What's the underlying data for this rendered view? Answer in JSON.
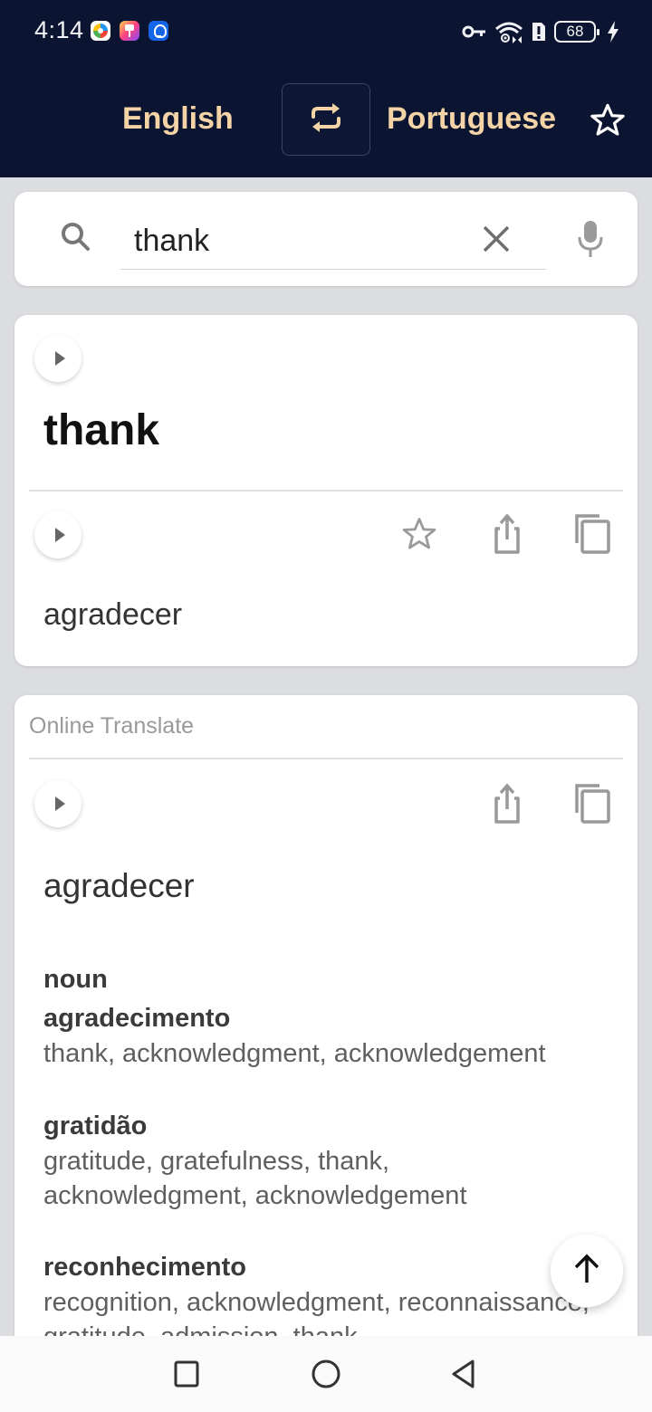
{
  "status_bar": {
    "time": "4:14",
    "notification_icons": [
      "app-icon-colorful-circle",
      "app-icon-paintbrush",
      "app-icon-lightbulb"
    ],
    "right_icons": [
      "vpn-key-icon",
      "wifi-icon",
      "sim-alert-icon",
      "battery-icon",
      "charging-icon"
    ],
    "battery_level": "68"
  },
  "header": {
    "source_language": "English",
    "target_language": "Portuguese",
    "swap_icon": "swap-icon",
    "favorites_icon": "star-outline-icon",
    "background": "#0b1431",
    "accent": "#f4d3a6"
  },
  "search": {
    "value": "thank",
    "placeholder": "",
    "icons": [
      "search-icon",
      "clear-icon",
      "mic-icon"
    ]
  },
  "dictionary_result": {
    "headword": "thank",
    "translation": "agradecer",
    "actions": [
      "star-outline-icon",
      "share-icon",
      "copy-icon"
    ]
  },
  "online_translate": {
    "label": "Online Translate",
    "translation": "agradecer",
    "actions": [
      "share-icon",
      "copy-icon"
    ],
    "part_of_speech": "noun",
    "entries": [
      {
        "word": "agradecimento",
        "synonyms": "thank, acknowledgment, acknowledgement"
      },
      {
        "word": "gratidão",
        "synonyms": "gratitude, gratefulness, thank, acknowledgment, acknowledgement"
      },
      {
        "word": "reconhecimento",
        "synonyms": "recognition, acknowledgment, reconnaissance, gratitude, admission, thank"
      }
    ]
  },
  "floating": {
    "scroll_top_icon": "arrow-up-icon"
  },
  "nav_bar": {
    "buttons": [
      "recents-square-icon",
      "home-circle-icon",
      "back-triangle-icon"
    ]
  }
}
